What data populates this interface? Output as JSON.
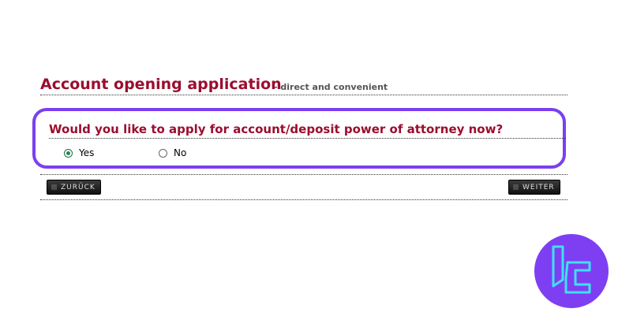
{
  "header": {
    "title": "Account opening application",
    "subtitle": "- direct and convenient"
  },
  "question": {
    "text": "Would you like to apply for account/deposit power of attorney now?",
    "options": [
      {
        "label": "Yes",
        "selected": true
      },
      {
        "label": "No",
        "selected": false
      }
    ]
  },
  "nav": {
    "back_label": "ZURÜCK",
    "next_label": "WEITER"
  },
  "colors": {
    "title": "#9b0d2e",
    "highlight": "#7b3ff0",
    "radio_selected": "#1e8a50",
    "logo_bg": "#7e3ff3",
    "logo_stroke": "#3fe0f5"
  }
}
